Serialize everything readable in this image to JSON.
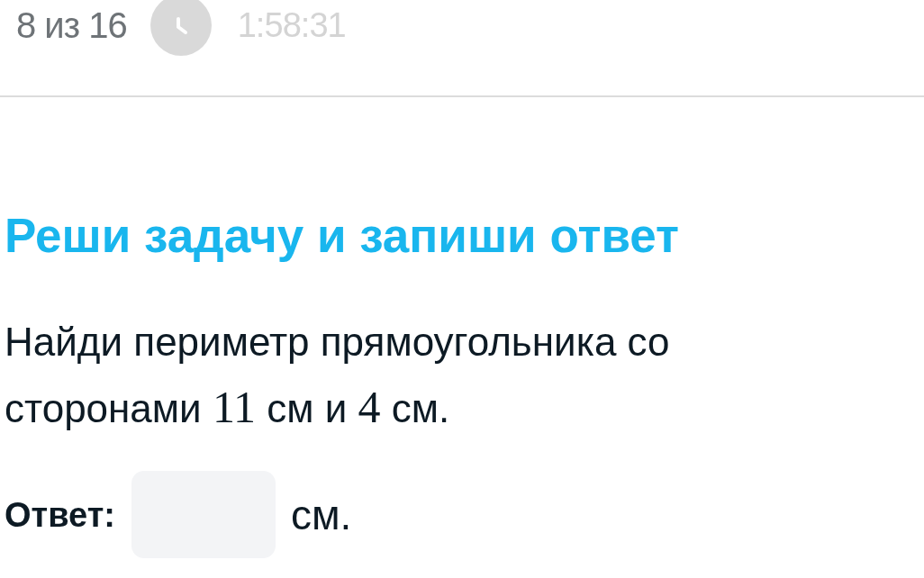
{
  "header": {
    "progress": "8 из 16",
    "timer": "1:58:31"
  },
  "task": {
    "title": "Реши задачу и запиши ответ",
    "statement": [
      {
        "kind": "text",
        "text": "Найди периметр прямоугольника со сторонами "
      },
      {
        "kind": "math",
        "text": "11"
      },
      {
        "kind": "text",
        "text": " см и "
      },
      {
        "kind": "math",
        "text": "4"
      },
      {
        "kind": "text",
        "text": " см."
      }
    ]
  },
  "answer": {
    "label": "Ответ:",
    "unit": "см."
  }
}
